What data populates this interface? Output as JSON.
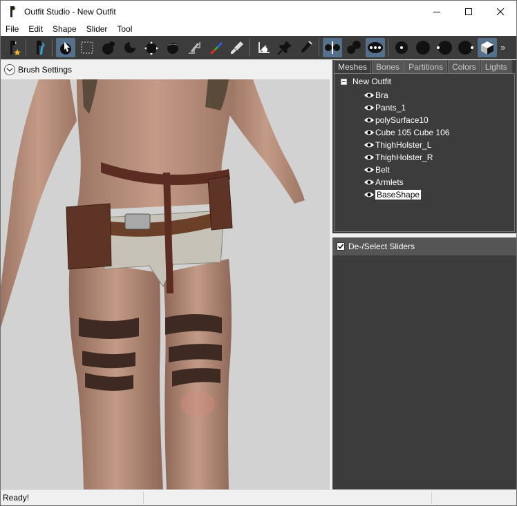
{
  "window": {
    "title": "Outfit Studio - New Outfit"
  },
  "menu": {
    "items": [
      "File",
      "Edit",
      "Shape",
      "Slider",
      "Tool"
    ]
  },
  "toolbar": {
    "more": "»",
    "groups": [
      [
        "new-project-icon"
      ],
      [
        "load-reference-icon"
      ],
      [
        "select-tool-icon",
        "mask-rect-icon",
        "inflate-brush-icon",
        "deflate-brush-icon",
        "move-brush-icon",
        "smooth-brush-icon",
        "undiff-brush-icon",
        "weight-paint-icon",
        "color-paint-icon"
      ],
      [
        "transform-icon",
        "pivot-icon",
        "collapse-vertex-icon"
      ],
      [
        "mirror-x-icon",
        "connected-only-icon",
        "global-brush-icon"
      ],
      [
        "wireframe-icon",
        "lighting-icon",
        "mask-view-icon",
        "weight-view-icon",
        "texture-view-icon"
      ]
    ],
    "active": [
      "select-tool-icon",
      "mirror-x-icon",
      "global-brush-icon",
      "texture-view-icon"
    ]
  },
  "brush": {
    "label": "Brush Settings"
  },
  "tabs": [
    "Meshes",
    "Bones",
    "Partitions",
    "Colors",
    "Lights"
  ],
  "active_tab": "Meshes",
  "tree": {
    "root": "New Outfit",
    "meshes": [
      "Bra",
      "Pants_1",
      "polySurface10",
      "Cube 105 Cube 106",
      "ThighHolster_L",
      "ThighHolster_R",
      "Belt",
      "Armlets",
      "BaseShape"
    ],
    "selected": "BaseShape"
  },
  "sliders": {
    "header": "De-/Select Sliders",
    "checked": true
  },
  "status": {
    "text": "Ready!"
  }
}
